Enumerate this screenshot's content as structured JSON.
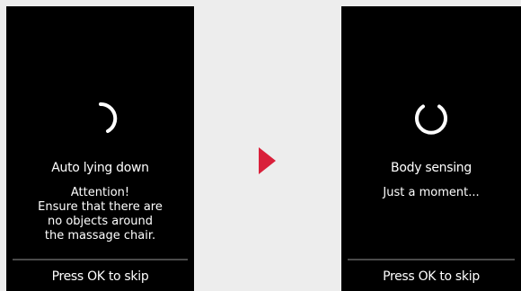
{
  "left_screen": {
    "title": "Auto lying down",
    "message": "Attention!\nEnsure that there are\nno objects around\nthe massage chair.",
    "skip_label": "Press OK to skip"
  },
  "right_screen": {
    "title": "Body sensing",
    "message": "Just a moment...",
    "skip_label": "Press OK to skip"
  },
  "icons": {
    "spinner": "loading-spinner-icon",
    "arrow": "next-arrow-icon"
  },
  "colors": {
    "screen_background": "#000000",
    "page_background": "#ededed",
    "arrow": "#d9203a",
    "text": "#ffffff"
  }
}
